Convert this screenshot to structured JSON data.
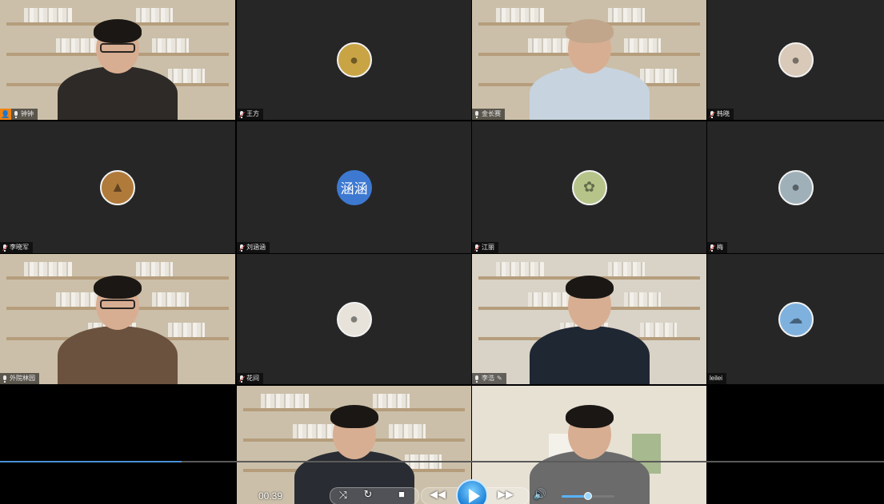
{
  "participants": [
    {
      "name": "钟钟",
      "type": "video",
      "host": true,
      "mic": true
    },
    {
      "name": "王方",
      "type": "avatar",
      "mic": "muted",
      "avatar": {
        "kind": "photo",
        "color": "#c9a445",
        "icon": "portrait-photo"
      }
    },
    {
      "name": "金长赛",
      "type": "video",
      "mic": true
    },
    {
      "name": "韩晓",
      "type": "avatar",
      "mic": "muted",
      "avatar": {
        "kind": "photo",
        "color": "#d9c9b8",
        "icon": "portrait-photo"
      }
    },
    {
      "name": "李晓军",
      "type": "avatar",
      "mic": "muted",
      "avatar": {
        "kind": "photo",
        "color": "#b07a3a",
        "icon": "landscape-photo"
      }
    },
    {
      "name": "刘涵涵",
      "type": "avatar",
      "mic": "muted",
      "avatar": {
        "kind": "text",
        "text": "涵涵",
        "color": "#3d79d1"
      }
    },
    {
      "name": "江丽",
      "type": "avatar",
      "mic": "muted",
      "avatar": {
        "kind": "photo",
        "color": "#b6c48a",
        "icon": "flower-photo"
      }
    },
    {
      "name": "梅",
      "type": "avatar",
      "mic": "muted",
      "avatar": {
        "kind": "photo",
        "color": "#9fb0b8",
        "icon": "portrait-photo"
      }
    },
    {
      "name": "外院林园",
      "type": "video",
      "mic": true
    },
    {
      "name": "花间",
      "type": "avatar",
      "mic": "muted",
      "avatar": {
        "kind": "photo",
        "color": "#e8e3da",
        "icon": "portrait-photo"
      }
    },
    {
      "name": "李浩",
      "type": "video",
      "mic": true,
      "editing": true
    },
    {
      "name": "leilei",
      "type": "avatar",
      "mic": false,
      "avatar": {
        "kind": "photo",
        "color": "#7fb1de",
        "icon": "sky-photo"
      }
    },
    {
      "name": "",
      "type": "empty"
    },
    {
      "name": "",
      "type": "video"
    },
    {
      "name": "",
      "type": "video",
      "active": true
    },
    {
      "name": "",
      "type": "empty"
    }
  ],
  "player": {
    "elapsed": "00:39",
    "progress_fraction": 0.205,
    "volume_fraction": 0.5,
    "accent": "#4a90d9"
  }
}
